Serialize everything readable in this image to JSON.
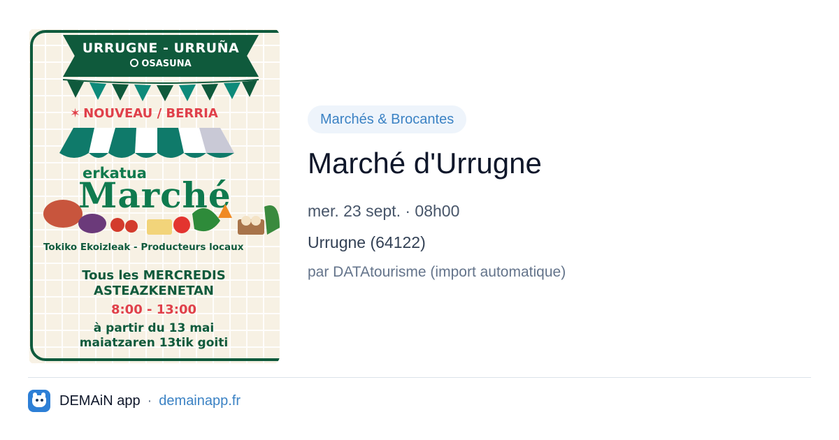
{
  "poster": {
    "top_title": "URRUGNE - URRUÑA",
    "top_subtitle": "OSASUNA",
    "new_label": "NOUVEAU / BERRIA",
    "brand_sub": "erkatua",
    "brand_title": "Marché",
    "producers": "Tokiko Ekoizleak - Producteurs locaux",
    "days_fr": "Tous les MERCREDIS",
    "days_eu": "ASTEAZKENETAN",
    "hours": "8:00 - 13:00",
    "from_fr": "à partir du 13 mai",
    "from_eu": "maiatzaren 13tik goiti"
  },
  "event": {
    "category": "Marchés & Brocantes",
    "title": "Marché d'Urrugne",
    "date": "mer. 23 sept. · 08h00",
    "place": "Urrugne (64122)",
    "author": "par DATAtourisme (import automatique)"
  },
  "footer": {
    "app_name": "DEMAiN app",
    "separator": "·",
    "link": "demainapp.fr"
  },
  "colors": {
    "accent": "#3b82c4",
    "badge_bg": "#eef4fb",
    "poster_green": "#0f5a3c",
    "poster_red": "#e0404a"
  }
}
